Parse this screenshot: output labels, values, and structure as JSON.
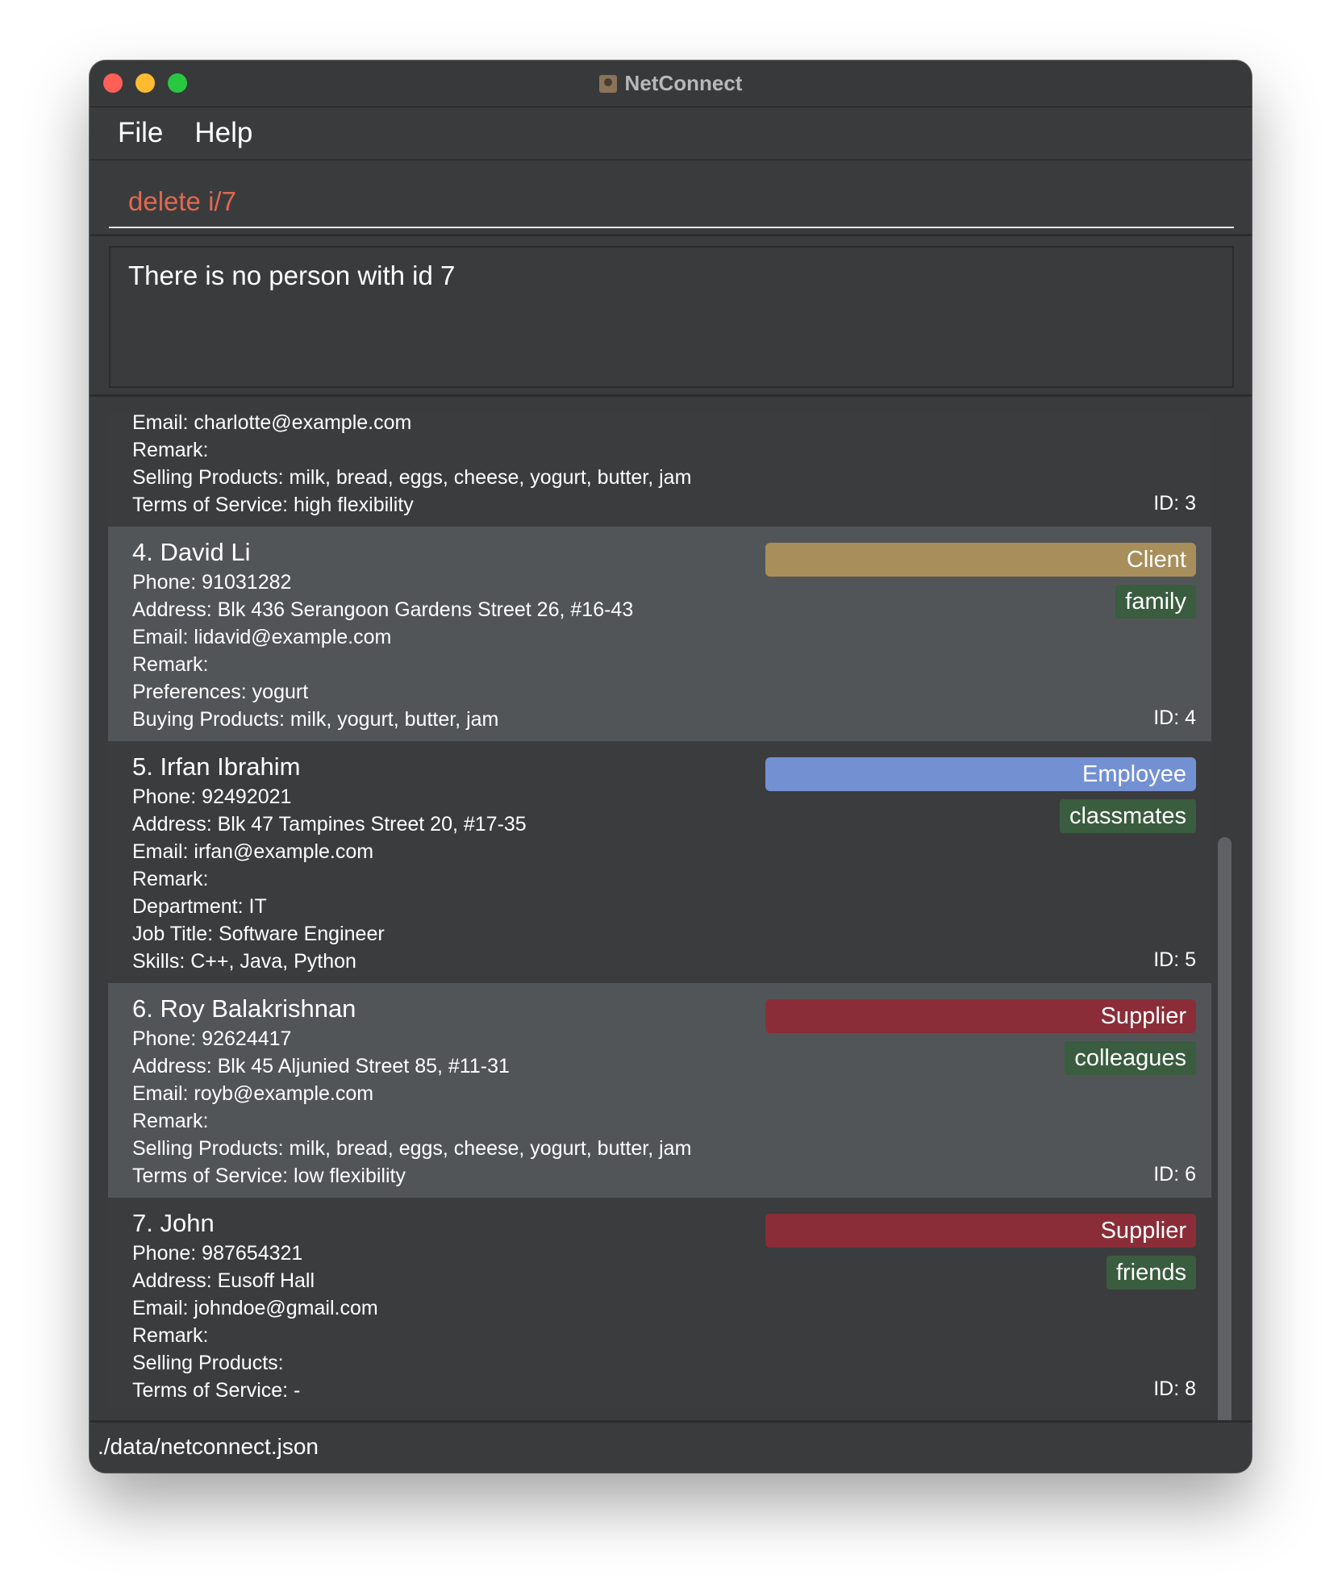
{
  "window": {
    "title": "NetConnect"
  },
  "menu": {
    "file": "File",
    "help": "Help"
  },
  "command": {
    "value": "delete i/7"
  },
  "result": {
    "text": "There is no person with id 7"
  },
  "colors": {
    "client": "#a78e5b",
    "employee": "#7391d2",
    "supplier": "#8b2d38",
    "tag": "#3a5c3f",
    "command_text": "#e0694f"
  },
  "persons": [
    {
      "partial": true,
      "fields": [
        "Email: charlotte@example.com",
        "Remark:",
        "Selling Products: milk, bread, eggs, cheese, yogurt, butter, jam",
        "Terms of Service: high flexibility"
      ],
      "id": "ID: 3"
    },
    {
      "name": "4.  David Li",
      "role": "Client",
      "tag": "family",
      "fields": [
        "Phone: 91031282",
        "Address: Blk 436 Serangoon Gardens Street 26, #16-43",
        "Email: lidavid@example.com",
        "Remark:",
        "Preferences: yogurt",
        "Buying Products: milk, yogurt, butter, jam"
      ],
      "id": "ID: 4"
    },
    {
      "name": "5.  Irfan Ibrahim",
      "role": "Employee",
      "tag": "classmates",
      "fields": [
        "Phone: 92492021",
        "Address: Blk 47 Tampines Street 20, #17-35",
        "Email: irfan@example.com",
        "Remark:",
        "Department: IT",
        "Job Title: Software Engineer",
        "Skills: C++, Java, Python"
      ],
      "id": "ID: 5"
    },
    {
      "name": "6.  Roy Balakrishnan",
      "role": "Supplier",
      "tag": "colleagues",
      "fields": [
        "Phone: 92624417",
        "Address: Blk 45 Aljunied Street 85, #11-31",
        "Email: royb@example.com",
        "Remark:",
        "Selling Products: milk, bread, eggs, cheese, yogurt, butter, jam",
        "Terms of Service: low flexibility"
      ],
      "id": "ID: 6"
    },
    {
      "name": "7.  John",
      "role": "Supplier",
      "tag": "friends",
      "fields": [
        "Phone: 987654321",
        "Address: Eusoff Hall",
        "Email: johndoe@gmail.com",
        "Remark:",
        "Selling Products:",
        "Terms of Service: -"
      ],
      "id": "ID: 8"
    }
  ],
  "status": {
    "path": "./data/netconnect.json"
  }
}
